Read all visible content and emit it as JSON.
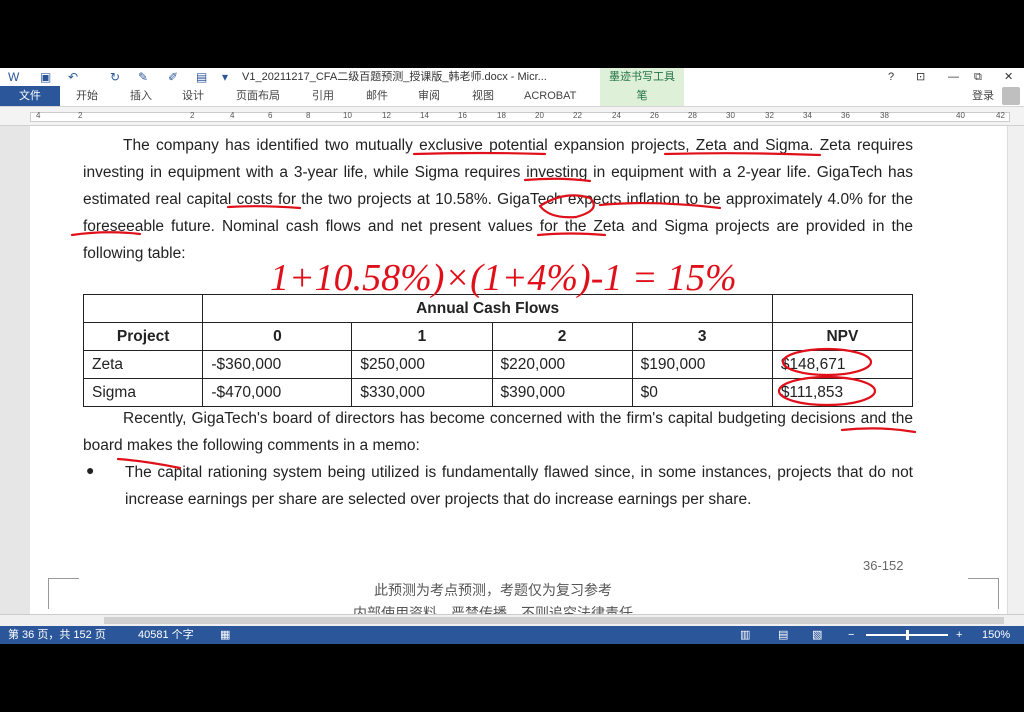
{
  "window": {
    "doc_title": "V1_20211217_CFA二级百题预测_授课版_韩老师.docx - Micr...",
    "contextual_tab": "墨迹书写工具",
    "controls": [
      "?",
      "⊡",
      "—",
      "⧉",
      "✕"
    ]
  },
  "ribbon": {
    "tabs": [
      "文件",
      "开始",
      "插入",
      "设计",
      "页面布局",
      "引用",
      "邮件",
      "审阅",
      "视图",
      "ACROBAT"
    ],
    "pen_tab": "笔",
    "login": "登录"
  },
  "ruler": {
    "ticks": [
      "4",
      "2",
      "2",
      "4",
      "6",
      "8",
      "10",
      "12",
      "14",
      "16",
      "18",
      "20",
      "22",
      "24",
      "26",
      "28",
      "30",
      "32",
      "34",
      "36",
      "38",
      "40",
      "42"
    ]
  },
  "document": {
    "lines": [
      "The company has identified two mutually exclusive potential expansion projects, Zeta and",
      "Sigma. Zeta requires investing in equipment with a 3-year life, while Sigma requires investing in",
      "equipment with a 2-year life. GigaTech has estimated real capital costs for the two projects at",
      "10.58%. GigaTech expects inflation to be approximately 4.0% for the foreseeable future. Nominal",
      "cash flows and net present values for the Zeta and Sigma projects are provided in the following",
      "table:"
    ],
    "table": {
      "group_header": "Annual Cash Flows",
      "headers": [
        "Project",
        "0",
        "1",
        "2",
        "3",
        "NPV"
      ],
      "rows": [
        [
          "Zeta",
          "-$360,000",
          "$250,000",
          "$220,000",
          "$190,000",
          "$148,671"
        ],
        [
          "Sigma",
          "-$470,000",
          "$330,000",
          "$390,000",
          "$0",
          "$111,853"
        ]
      ]
    },
    "after_lines": [
      "Recently, GigaTech's board of directors has become concerned with the firm's capital",
      "budgeting decisions and the board makes the following comments in a memo:"
    ],
    "bullet_lines": [
      "The capital rationing system being utilized is fundamentally flawed since, in some instances,",
      "projects that do not increase earnings per share are selected over projects that do increase",
      "earnings per share."
    ],
    "page_number": "36-152",
    "footer_notes": [
      "此预测为考点预测，考题仅为复习参考",
      "内部使用资料，严禁传播，不则追究法律责任"
    ],
    "handwritten_formula": "1+10.58%)×(1+4%)-1 = 15%"
  },
  "status_bar": {
    "page": "第 36 页，共 152 页",
    "words": "40581 个字",
    "zoom": "150%"
  },
  "colors": {
    "accent": "#2b579a",
    "ink": "#e0101a"
  }
}
